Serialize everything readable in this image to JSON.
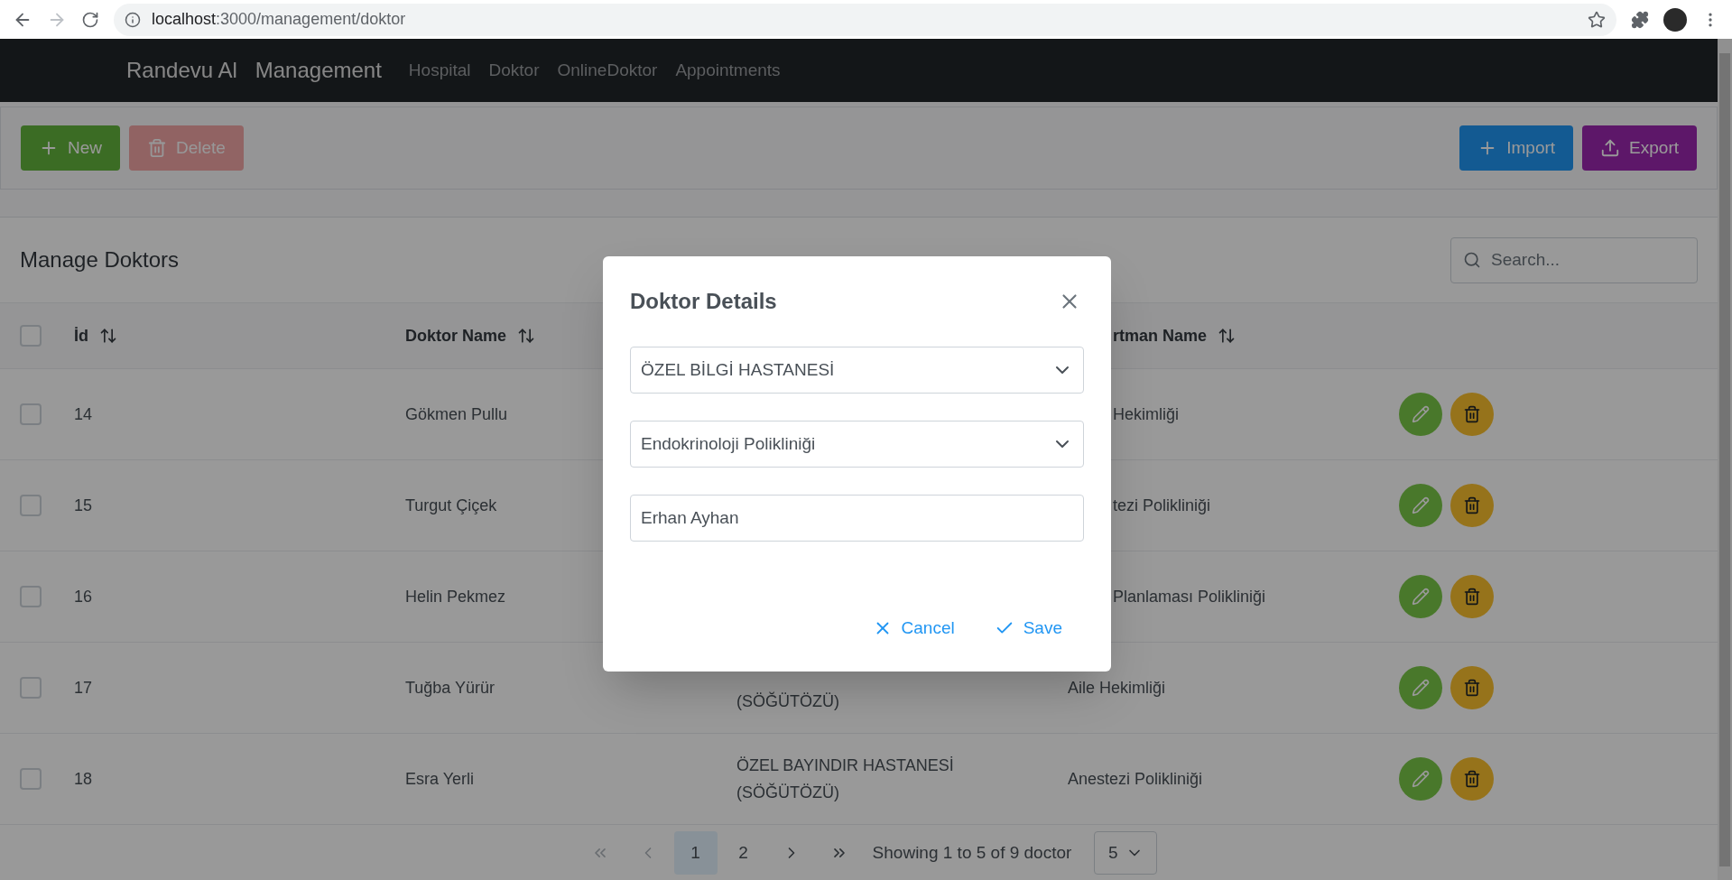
{
  "browser": {
    "url": {
      "host": "localhost",
      "rest": ":3000/management/doktor"
    }
  },
  "navbar": {
    "brand": "Randevu Al",
    "title": "Management",
    "links": [
      {
        "label": "Hospital"
      },
      {
        "label": "Doktor"
      },
      {
        "label": "OnlineDoktor"
      },
      {
        "label": "Appointments"
      }
    ]
  },
  "toolbar": {
    "left": [
      {
        "label": "New",
        "kind": "new",
        "disabled": false
      },
      {
        "label": "Delete",
        "kind": "delete",
        "disabled": true
      }
    ],
    "right": [
      {
        "label": "Import",
        "kind": "import"
      },
      {
        "label": "Export",
        "kind": "export"
      }
    ]
  },
  "table": {
    "title": "Manage Doktors",
    "search": {
      "placeholder": "Search..."
    },
    "header": {
      "checked": false,
      "id": "İd",
      "name": "Doktor Name",
      "column_4": "rtman Name"
    },
    "rows": [
      {
        "checked": false,
        "id": "14",
        "name": "Gökmen Pullu",
        "department": "Hekimliği"
      },
      {
        "checked": false,
        "id": "15",
        "name": "Turgut Çiçek",
        "department": "tezi Polikliniği"
      },
      {
        "checked": false,
        "id": "16",
        "name": "Helin Pekmez",
        "department": "Planlaması Polikliniği"
      },
      {
        "checked": false,
        "id": "17",
        "name": "Tuğba Yürür",
        "hospital": "(SÖĞÜTÖZÜ)",
        "department": "Aile Hekimliği"
      },
      {
        "checked": false,
        "id": "18",
        "name": "Esra Yerli",
        "hospital": "ÖZEL BAYINDIR HASTANESİ (SÖĞÜTÖZÜ)",
        "department": "Anestezi Polikliniği"
      }
    ]
  },
  "pagination": {
    "first_disabled": true,
    "prev_disabled": true,
    "next_disabled": false,
    "last_disabled": false,
    "pages": [
      {
        "label": "1",
        "selected": true
      },
      {
        "label": "2",
        "selected": false
      }
    ],
    "report": "Showing 1 to 5 of 9 doctor",
    "rows_per_page": "5"
  },
  "modal": {
    "title": "Doktor Details",
    "fields": [
      {
        "kind": "dropdown",
        "value": "ÖZEL BİLGİ HASTANESİ"
      },
      {
        "kind": "dropdown",
        "value": "Endokrinoloji Polikliniği"
      },
      {
        "kind": "text",
        "value": "Erhan Ayhan"
      }
    ],
    "buttons": [
      {
        "label": "Cancel",
        "kind": "cancel"
      },
      {
        "label": "Save",
        "kind": "save"
      }
    ]
  }
}
